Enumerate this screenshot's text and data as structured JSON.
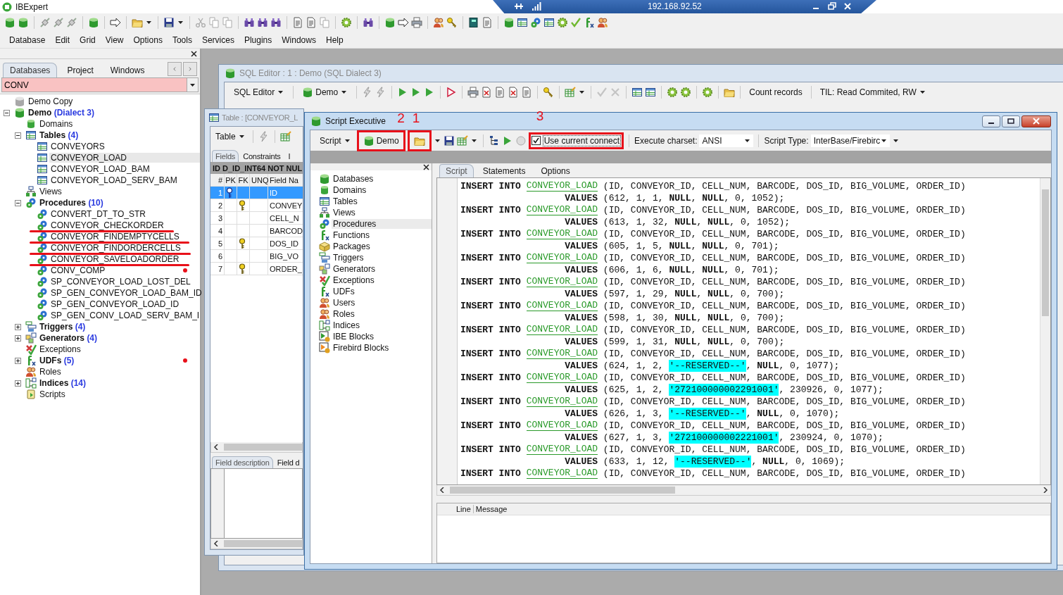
{
  "app": {
    "title": "IBExpert"
  },
  "remote_bar": {
    "address": "192.168.92.52"
  },
  "menu": [
    "Database",
    "Edit",
    "Grid",
    "View",
    "Options",
    "Tools",
    "Services",
    "Plugins",
    "Windows",
    "Help"
  ],
  "navigator": {
    "tabs": [
      {
        "label": "Databases",
        "selected": true
      },
      {
        "label": "Project",
        "selected": false
      },
      {
        "label": "Windows",
        "selected": false
      }
    ],
    "filter": "CONV",
    "tree": [
      {
        "label": "Demo Copy",
        "kind": "database",
        "connected": false,
        "selected": false
      },
      {
        "label": "Demo",
        "note": "(Dialect 3)",
        "kind": "database",
        "connected": true,
        "bold": true,
        "expanded": true,
        "selected": false,
        "children": [
          {
            "label": "Domains",
            "kind": "domain",
            "selected": false
          },
          {
            "label": "Tables",
            "count": "(4)",
            "kind": "table",
            "bold": true,
            "expanded": true,
            "selected": false,
            "children": [
              {
                "label": "CONVEYORS",
                "kind": "table",
                "selected": false
              },
              {
                "label": "CONVEYOR_LOAD",
                "kind": "table",
                "selected": true
              },
              {
                "label": "CONVEYOR_LOAD_BAM",
                "kind": "table",
                "selected": false
              },
              {
                "label": "CONVEYOR_LOAD_SERV_BAM",
                "kind": "table",
                "selected": false
              }
            ]
          },
          {
            "label": "Views",
            "kind": "view",
            "selected": false
          },
          {
            "label": "Procedures",
            "count": "(10)",
            "kind": "procedure",
            "bold": true,
            "expanded": true,
            "selected": false,
            "children": [
              {
                "label": "CONVERT_DT_TO_STR",
                "kind": "procedure",
                "selected": false
              },
              {
                "label": "CONVEYOR_CHECKORDER",
                "kind": "procedure",
                "selected": false,
                "underlined": true
              },
              {
                "label": "CONVEYOR_FINDEMPTYCELLS",
                "kind": "procedure",
                "selected": false,
                "underlined": true
              },
              {
                "label": "CONVEYOR_FINDORDERCELLS",
                "kind": "procedure",
                "selected": false,
                "underlined": true
              },
              {
                "label": "CONVEYOR_SAVELOADORDER",
                "kind": "procedure",
                "selected": false,
                "underlined": true
              },
              {
                "label": "CONV_COMP",
                "kind": "procedure",
                "selected": false,
                "flagged": true
              },
              {
                "label": "SP_CONVEYOR_LOAD_LOST_DEL",
                "kind": "procedure",
                "selected": false
              },
              {
                "label": "SP_GEN_CONVEYOR_LOAD_BAM_ID",
                "kind": "procedure",
                "selected": false
              },
              {
                "label": "SP_GEN_CONVEYOR_LOAD_ID",
                "kind": "procedure",
                "selected": false
              },
              {
                "label": "SP_GEN_CONV_LOAD_SERV_BAM_I",
                "kind": "procedure",
                "selected": false
              }
            ]
          },
          {
            "label": "Triggers",
            "count": "(4)",
            "kind": "trigger",
            "bold": true,
            "expanded": false,
            "selected": false
          },
          {
            "label": "Generators",
            "count": "(4)",
            "kind": "generator",
            "bold": true,
            "expanded": false,
            "selected": false
          },
          {
            "label": "Exceptions",
            "kind": "exception",
            "selected": false
          },
          {
            "label": "UDFs",
            "count": "(5)",
            "kind": "udf",
            "bold": true,
            "expanded": false,
            "selected": false,
            "flagged": true
          },
          {
            "label": "Roles",
            "kind": "role",
            "selected": false
          },
          {
            "label": "Indices",
            "count": "(14)",
            "kind": "index",
            "bold": true,
            "expanded": false,
            "selected": false
          },
          {
            "label": "Scripts",
            "kind": "script",
            "selected": false
          }
        ]
      }
    ]
  },
  "sql_editor": {
    "title": "SQL Editor : 1 : Demo (SQL Dialect 3)",
    "menu_button": "SQL Editor",
    "database_button": "Demo",
    "count_records": "Count records",
    "transaction": "TIL: Read Commited, RW"
  },
  "table_window": {
    "title": "Table : [CONVEYOR_L",
    "menu_button": "Table",
    "tabs": [
      {
        "label": "Fields",
        "selected": true
      },
      {
        "label": "Constraints",
        "selected": false
      },
      {
        "label": "I",
        "selected": false
      }
    ],
    "field_info": "ID D_ID_INT64 NOT NUL",
    "columns": [
      "#",
      "PK",
      "FK",
      "UNQ",
      "Field Na"
    ],
    "rows": [
      {
        "num": "1",
        "pk": true,
        "fk": false,
        "name": "ID",
        "selected": true
      },
      {
        "num": "2",
        "pk": false,
        "fk": true,
        "name": "CONVEY",
        "selected": false
      },
      {
        "num": "3",
        "pk": false,
        "fk": false,
        "name": "CELL_N",
        "selected": false
      },
      {
        "num": "4",
        "pk": false,
        "fk": false,
        "name": "BARCOD",
        "selected": false
      },
      {
        "num": "5",
        "pk": false,
        "fk": true,
        "name": "DOS_ID",
        "selected": false
      },
      {
        "num": "6",
        "pk": false,
        "fk": false,
        "name": "BIG_VO",
        "selected": false
      },
      {
        "num": "7",
        "pk": false,
        "fk": true,
        "name": "ORDER_",
        "selected": false
      }
    ],
    "bottom_tabs": [
      {
        "label": "Field description",
        "selected": true
      },
      {
        "label": "Field d",
        "selected": false
      }
    ]
  },
  "script_executive": {
    "title": "Script Executive",
    "menu_button": "Script",
    "database_button": {
      "label": "Demo",
      "highlighted": true,
      "callout": "2"
    },
    "open_button": {
      "highlighted": true,
      "callout": "1"
    },
    "use_current_connection": {
      "label": "Use current connect",
      "checked": true,
      "highlighted": true,
      "callout": "3"
    },
    "charset_label": "Execute charset:",
    "charset": "ANSI",
    "script_type_label": "Script Type:",
    "script_type": "InterBase/Firebirc",
    "objects": [
      {
        "label": "Databases",
        "kind": "database",
        "selected": false
      },
      {
        "label": "Domains",
        "kind": "domain",
        "selected": false
      },
      {
        "label": "Tables",
        "kind": "table",
        "selected": false
      },
      {
        "label": "Views",
        "kind": "view",
        "selected": false
      },
      {
        "label": "Procedures",
        "kind": "procedure",
        "selected": true
      },
      {
        "label": "Functions",
        "kind": "udf",
        "selected": false
      },
      {
        "label": "Packages",
        "kind": "package",
        "selected": false
      },
      {
        "label": "Triggers",
        "kind": "trigger",
        "selected": false
      },
      {
        "label": "Generators",
        "kind": "generator",
        "selected": false
      },
      {
        "label": "Exceptions",
        "kind": "exception",
        "selected": false
      },
      {
        "label": "UDFs",
        "kind": "udf",
        "selected": false
      },
      {
        "label": "Users",
        "kind": "role",
        "selected": false
      },
      {
        "label": "Roles",
        "kind": "role",
        "selected": false
      },
      {
        "label": "Indices",
        "kind": "index",
        "selected": false
      },
      {
        "label": "IBE Blocks",
        "kind": "block",
        "selected": false
      },
      {
        "label": "Firebird Blocks",
        "kind": "fbblock",
        "selected": false
      }
    ],
    "tabs": [
      {
        "label": "Script",
        "selected": true
      },
      {
        "label": "Statements",
        "selected": false
      },
      {
        "label": "Options",
        "selected": false
      }
    ],
    "lines": [
      {
        "kind": "insert",
        "keyword": "INSERT INTO",
        "table": "CONVEYOR_LOAD",
        "text": "(ID, CONVEYOR_ID, CELL_NUM, BARCODE, DOS_ID, BIG_VOLUME, ORDER_ID)"
      },
      {
        "kind": "values",
        "keyword": "VALUES",
        "text": "(612, 1, 1, **NULL**, **NULL**, 0, 1052);"
      },
      {
        "kind": "insert",
        "keyword": "INSERT INTO",
        "table": "CONVEYOR_LOAD",
        "text": "(ID, CONVEYOR_ID, CELL_NUM, BARCODE, DOS_ID, BIG_VOLUME, ORDER_ID)"
      },
      {
        "kind": "values",
        "keyword": "VALUES",
        "text": "(613, 1, 32, **NULL**, **NULL**, 0, 1052);"
      },
      {
        "kind": "insert",
        "keyword": "INSERT INTO",
        "table": "CONVEYOR_LOAD",
        "text": "(ID, CONVEYOR_ID, CELL_NUM, BARCODE, DOS_ID, BIG_VOLUME, ORDER_ID)"
      },
      {
        "kind": "values",
        "keyword": "VALUES",
        "text": "(605, 1, 5, **NULL**, **NULL**, 0, 701);"
      },
      {
        "kind": "insert",
        "keyword": "INSERT INTO",
        "table": "CONVEYOR_LOAD",
        "text": "(ID, CONVEYOR_ID, CELL_NUM, BARCODE, DOS_ID, BIG_VOLUME, ORDER_ID)"
      },
      {
        "kind": "values",
        "keyword": "VALUES",
        "text": "(606, 1, 6, **NULL**, **NULL**, 0, 701);"
      },
      {
        "kind": "insert",
        "keyword": "INSERT INTO",
        "table": "CONVEYOR_LOAD",
        "text": "(ID, CONVEYOR_ID, CELL_NUM, BARCODE, DOS_ID, BIG_VOLUME, ORDER_ID)"
      },
      {
        "kind": "values",
        "keyword": "VALUES",
        "text": "(597, 1, 29, **NULL**, **NULL**, 0, 700);"
      },
      {
        "kind": "insert",
        "keyword": "INSERT INTO",
        "table": "CONVEYOR_LOAD",
        "text": "(ID, CONVEYOR_ID, CELL_NUM, BARCODE, DOS_ID, BIG_VOLUME, ORDER_ID)"
      },
      {
        "kind": "values",
        "keyword": "VALUES",
        "text": "(598, 1, 30, **NULL**, **NULL**, 0, 700);"
      },
      {
        "kind": "insert",
        "keyword": "INSERT INTO",
        "table": "CONVEYOR_LOAD",
        "text": "(ID, CONVEYOR_ID, CELL_NUM, BARCODE, DOS_ID, BIG_VOLUME, ORDER_ID)"
      },
      {
        "kind": "values",
        "keyword": "VALUES",
        "text": "(599, 1, 31, **NULL**, **NULL**, 0, 700);"
      },
      {
        "kind": "insert",
        "keyword": "INSERT INTO",
        "table": "CONVEYOR_LOAD",
        "text": "(ID, CONVEYOR_ID, CELL_NUM, BARCODE, DOS_ID, BIG_VOLUME, ORDER_ID)"
      },
      {
        "kind": "values",
        "keyword": "VALUES",
        "text": "(624, 1, 2,",
        "string": "'--RESERVED--'",
        "tail": ", **NULL**, 0, 1077);"
      },
      {
        "kind": "insert",
        "keyword": "INSERT INTO",
        "table": "CONVEYOR_LOAD",
        "text": "(ID, CONVEYOR_ID, CELL_NUM, BARCODE, DOS_ID, BIG_VOLUME, ORDER_ID)"
      },
      {
        "kind": "values",
        "keyword": "VALUES",
        "text": "(625, 1, 2,",
        "string": "'272100000002291001'",
        "tail": ", 230926, 0, 1077);"
      },
      {
        "kind": "insert",
        "keyword": "INSERT INTO",
        "table": "CONVEYOR_LOAD",
        "text": "(ID, CONVEYOR_ID, CELL_NUM, BARCODE, DOS_ID, BIG_VOLUME, ORDER_ID)"
      },
      {
        "kind": "values",
        "keyword": "VALUES",
        "text": "(626, 1, 3,",
        "string": "'--RESERVED--'",
        "tail": ", **NULL**, 0, 1070);"
      },
      {
        "kind": "insert",
        "keyword": "INSERT INTO",
        "table": "CONVEYOR_LOAD",
        "text": "(ID, CONVEYOR_ID, CELL_NUM, BARCODE, DOS_ID, BIG_VOLUME, ORDER_ID)"
      },
      {
        "kind": "values",
        "keyword": "VALUES",
        "text": "(627, 1, 3,",
        "string": "'272100000002221001'",
        "tail": ", 230924, 0, 1070);"
      },
      {
        "kind": "insert",
        "keyword": "INSERT INTO",
        "table": "CONVEYOR_LOAD",
        "text": "(ID, CONVEYOR_ID, CELL_NUM, BARCODE, DOS_ID, BIG_VOLUME, ORDER_ID)"
      },
      {
        "kind": "values",
        "keyword": "VALUES",
        "text": "(633, 1, 12,",
        "string": "'--RESERVED--'",
        "tail": ", **NULL**, 0, 1069);"
      },
      {
        "kind": "insert",
        "keyword": "INSERT INTO",
        "table": "CONVEYOR_LOAD",
        "text": "(ID, CONVEYOR_ID, CELL_NUM, BARCODE, DOS_ID, BIG_VOLUME, ORDER_ID)"
      }
    ],
    "message_columns": [
      "Line",
      "Message"
    ]
  }
}
